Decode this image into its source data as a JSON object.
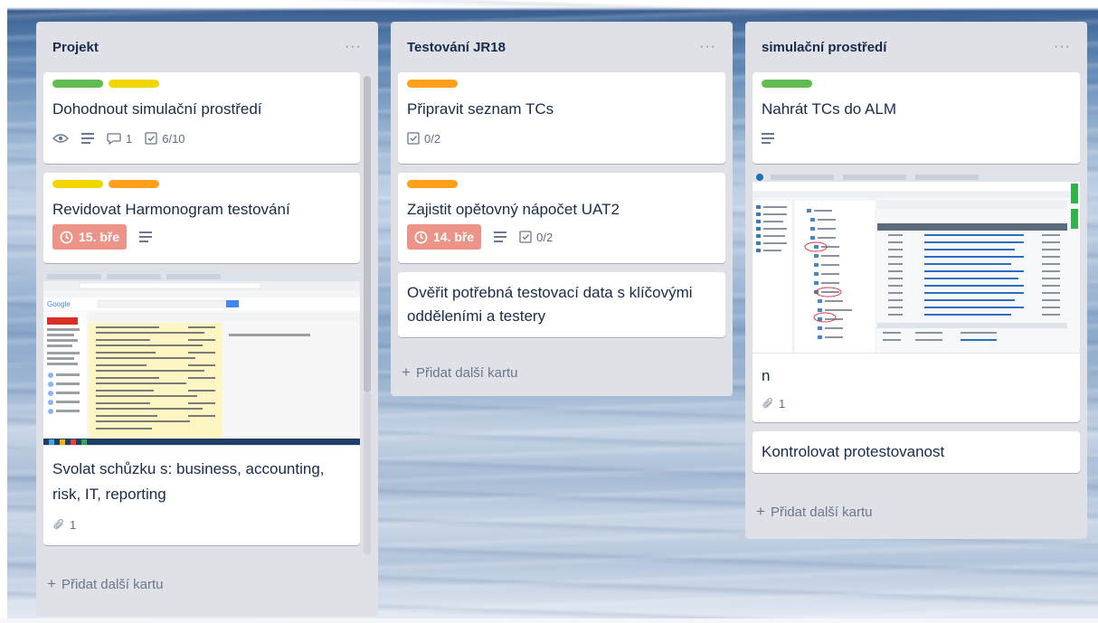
{
  "lists": [
    {
      "title": "Projekt",
      "menu": "···",
      "add_card": "Přidat další kartu",
      "cards": [
        {
          "labels": [
            "#61bd4f",
            "#f2d600"
          ],
          "title": "Dohodnout simulační prostředí",
          "comments": "1",
          "checklist": "6/10"
        },
        {
          "labels": [
            "#f2d600",
            "#ff9f1a"
          ],
          "title": "Revidovat Harmonogram testování",
          "due": "15. bře"
        },
        {
          "title": "Svolat schůzku s: business, accounting, risk, IT, reporting",
          "attachments": "1"
        }
      ]
    },
    {
      "title": "Testování JR18",
      "menu": "···",
      "add_card": "Přidat další kartu",
      "cards": [
        {
          "labels": [
            "#ff9f1a"
          ],
          "title": "Připravit seznam TCs",
          "checklist": "0/2"
        },
        {
          "labels": [
            "#ff9f1a"
          ],
          "title": "Zajistit opětovný nápočet UAT2",
          "due": "14. bře",
          "checklist": "0/2"
        },
        {
          "title": "Ověřit potřebná testovací data s klíčovými odděleními a testery"
        }
      ]
    },
    {
      "title": "simulační prostředí",
      "menu": "···",
      "add_card": "Přidat další kartu",
      "cards": [
        {
          "labels": [
            "#61bd4f"
          ],
          "title": "Nahrát TCs do ALM"
        },
        {
          "title": "n",
          "attachments": "1"
        },
        {
          "title": "Kontrolovat protestovanost"
        }
      ]
    }
  ],
  "colors": {
    "list_bg": "#dfe1e6",
    "due_overdue": "#ec9488",
    "label_green": "#61bd4f",
    "label_yellow": "#f2d600",
    "label_orange": "#ff9f1a"
  }
}
